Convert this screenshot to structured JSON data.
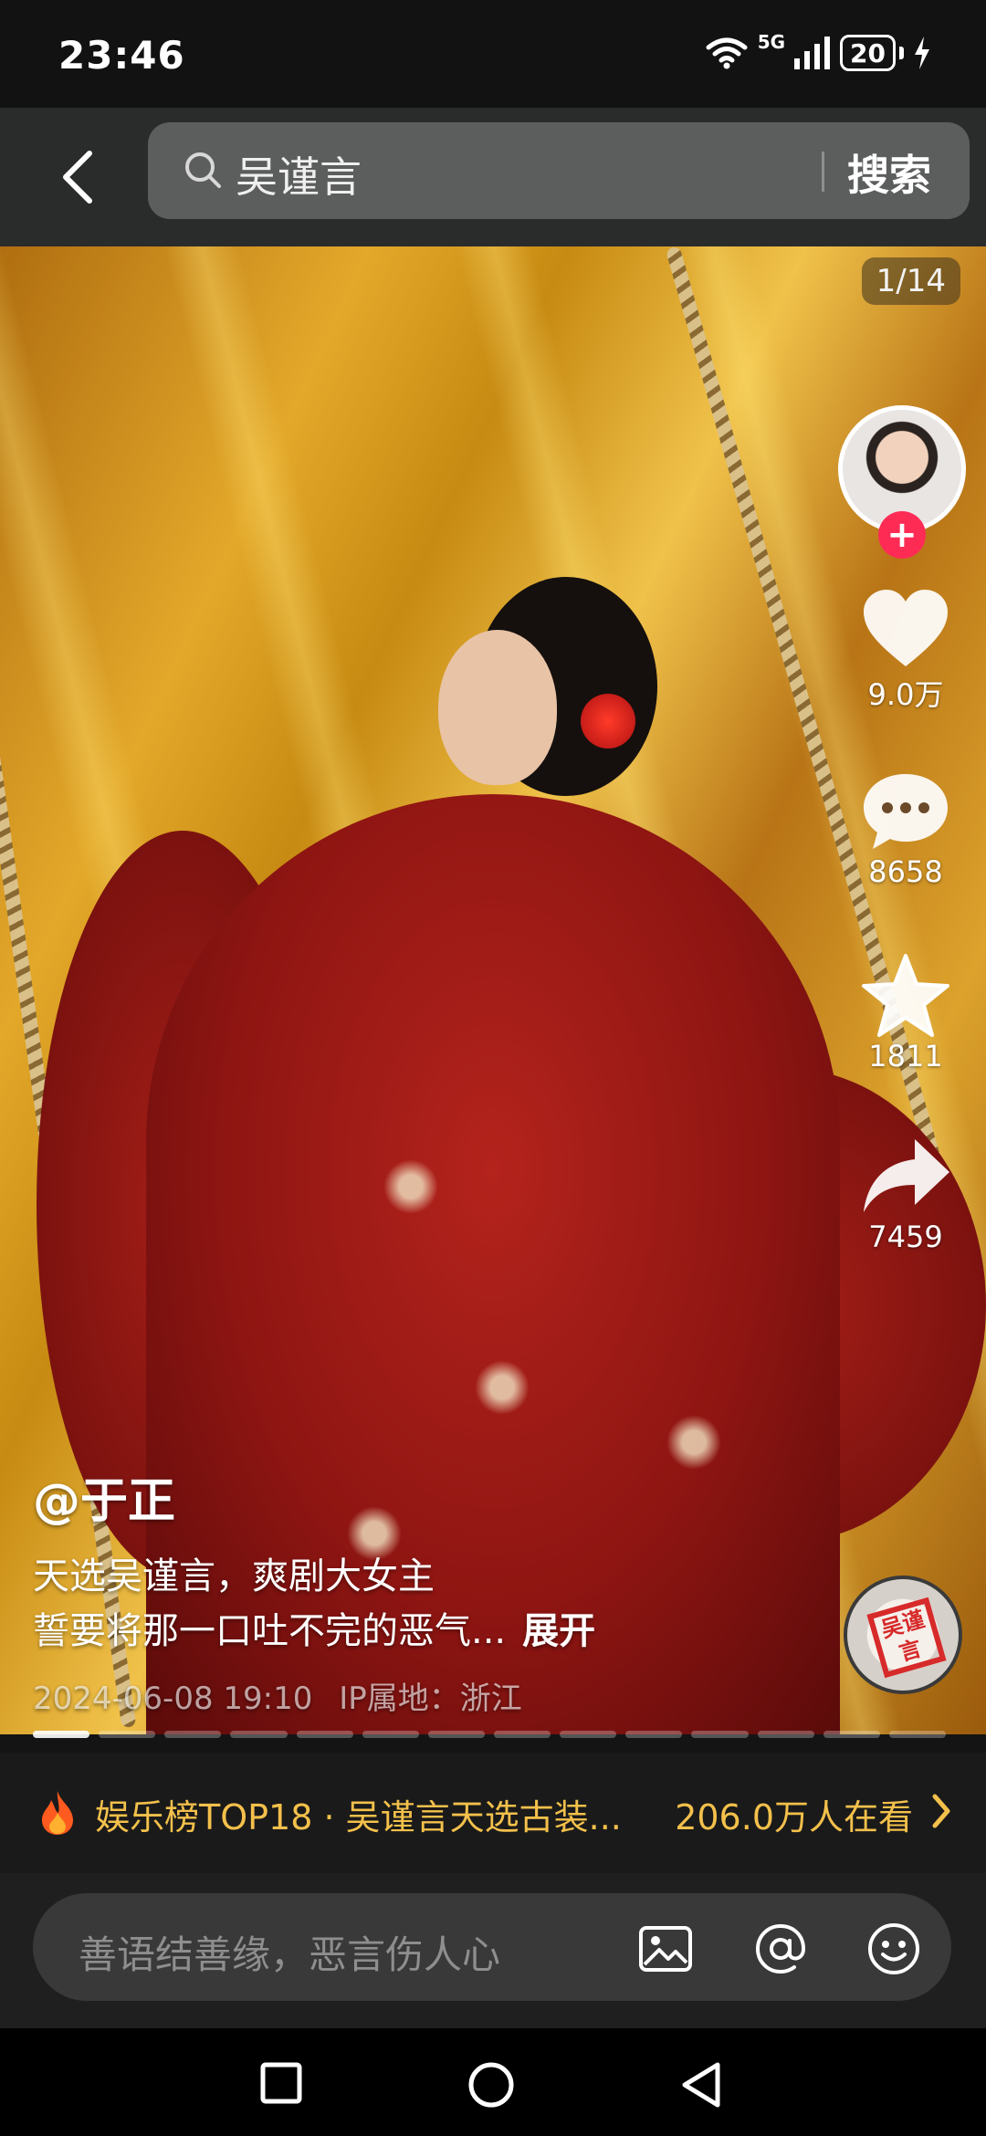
{
  "status_bar": {
    "time": "23:46",
    "network": "5G",
    "battery": "20"
  },
  "search": {
    "query": "吴谨言",
    "button_label": "搜索"
  },
  "post": {
    "page_counter": "1/14",
    "author": "@于正",
    "description_line1": "天选吴谨言，爽剧大女主",
    "description_line2": "誓要将那一口吐不完的恶气...",
    "expand_label": "展开",
    "date": "2024-06-08 19:10",
    "ip_location": "IP属地：浙江",
    "image_count": 14,
    "current_image": 1
  },
  "actions": {
    "likes": "9.0万",
    "comments": "8658",
    "favorites": "1811",
    "shares": "7459",
    "music_disc_text": "吴谨言"
  },
  "trending": {
    "title": "娱乐榜TOP18 · 吴谨言天选古装...",
    "viewers": "206.0万人在看"
  },
  "comment": {
    "placeholder": "善语结善缘，恶言伤人心"
  },
  "colors": {
    "follow": "#fe2c55",
    "trend_text": "#f3c04b",
    "search_box": "#5c5e5d"
  },
  "icons": {
    "back": "chevron-left-icon",
    "search": "search-icon",
    "like": "heart-icon",
    "comment": "chat-bubble-icon",
    "favorite": "star-icon",
    "share": "share-arrow-icon",
    "trend": "fire-icon",
    "image": "image-icon",
    "mention": "at-icon",
    "emoji": "smile-icon"
  }
}
